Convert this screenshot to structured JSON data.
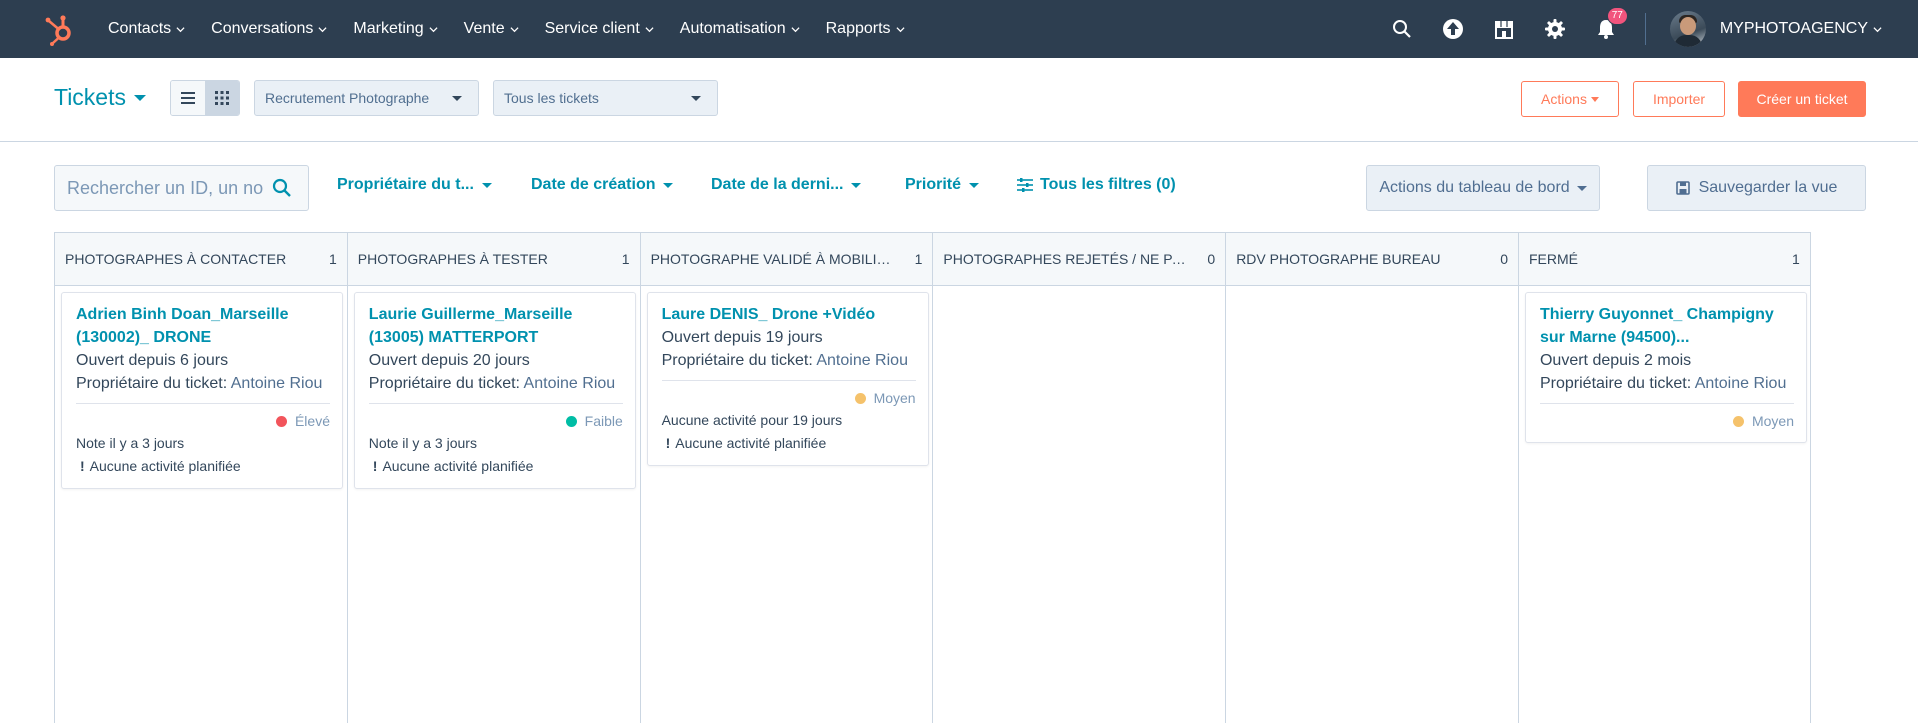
{
  "nav": {
    "items": [
      {
        "label": "Contacts"
      },
      {
        "label": "Conversations"
      },
      {
        "label": "Marketing"
      },
      {
        "label": "Vente"
      },
      {
        "label": "Service client"
      },
      {
        "label": "Automatisation"
      },
      {
        "label": "Rapports"
      }
    ],
    "notifications_count": "77",
    "account_name": "MYPHOTOAGENCY",
    "brand_color": "#ff7a59",
    "bar_color": "#2d3e50"
  },
  "header": {
    "title": "Tickets",
    "pipeline_select": "Recrutement Photographe",
    "view_select": "Tous les tickets",
    "actions_label": "Actions",
    "import_label": "Importer",
    "create_label": "Créer un ticket"
  },
  "filters": {
    "search_placeholder": "Rechercher un ID, un nom",
    "owner": "Propriétaire du t...",
    "created": "Date de création",
    "last": "Date de la derni...",
    "priority": "Priorité",
    "all_filters": "Tous les filtres (0)",
    "board_actions": "Actions du tableau de bord",
    "save_view": "Sauvegarder la vue"
  },
  "columns": [
    {
      "name": "PHOTOGRAPHES À CONTACTER",
      "count": "1"
    },
    {
      "name": "PHOTOGRAPHES À TESTER",
      "count": "1"
    },
    {
      "name": "PHOTOGRAPHE VALIDÉ À MOBILISER",
      "count": "1"
    },
    {
      "name": "PHOTOGRAPHES REJETÉS / NE PAS ...",
      "count": "0"
    },
    {
      "name": "RDV PHOTOGRAPHE BUREAU",
      "count": "0"
    },
    {
      "name": "FERMÉ",
      "count": "1"
    }
  ],
  "cards": {
    "c1": {
      "title": "Adrien Binh Doan_Marseille (130002)_ DRONE",
      "open": "Ouvert depuis 6 jours",
      "owner_label": "Propriétaire du ticket:",
      "owner": "Antoine Riou",
      "priority": "Élevé",
      "priority_color": "#f2545b",
      "note": "Note il y a 3 jours",
      "activity": "Aucune activité planifiée"
    },
    "c2": {
      "title": "Laurie Guillerme_Marseille (13005) MATTERPORT",
      "open": "Ouvert depuis 20 jours",
      "owner_label": "Propriétaire du ticket:",
      "owner": "Antoine Riou",
      "priority": "Faible",
      "priority_color": "#00bda5",
      "note": "Note il y a 3 jours",
      "activity": "Aucune activité planifiée"
    },
    "c3": {
      "title": "Laure DENIS_ Drone +Vidéo",
      "open": "Ouvert depuis 19 jours",
      "owner_label": "Propriétaire du ticket:",
      "owner": "Antoine Riou",
      "priority": "Moyen",
      "priority_color": "#f5c26b",
      "note": "Aucune activité pour 19 jours",
      "activity": "Aucune activité planifiée"
    },
    "c6": {
      "title": "Thierry Guyonnet_ Champigny sur Marne (94500)...",
      "open": "Ouvert depuis 2 mois",
      "owner_label": "Propriétaire du ticket:",
      "owner": "Antoine Riou",
      "priority": "Moyen",
      "priority_color": "#f5c26b"
    }
  }
}
